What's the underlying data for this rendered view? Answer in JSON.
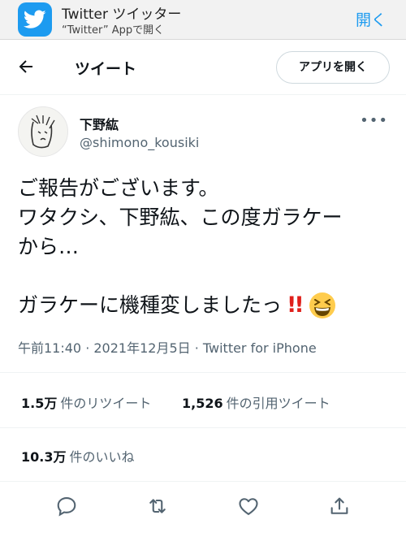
{
  "banner": {
    "title": "Twitter ツイッター",
    "subtitle": "“Twitter” Appで開く",
    "open_label": "開く"
  },
  "header": {
    "title": "ツイート",
    "open_app_label": "アプリを開く"
  },
  "author": {
    "name": "下野紘",
    "handle": "@shimono_kousiki"
  },
  "tweet": {
    "text": "ご報告がございます。\nワタクシ、下野紘、この度ガラケー\nから…",
    "text2": "ガラケーに機種変しましたっ",
    "emoji_bang": "!!",
    "meta": "午前11:40 · 2021年12月5日 · Twitter for iPhone"
  },
  "stats": {
    "retweets_count": "1.5万",
    "retweets_label": "件のリツイート",
    "quotes_count": "1,526",
    "quotes_label": "件の引用ツイート",
    "likes_count": "10.3万",
    "likes_label": "件のいいね"
  },
  "colors": {
    "accent": "#1d9bf0",
    "muted": "#536471",
    "divider": "#eff3f4"
  }
}
